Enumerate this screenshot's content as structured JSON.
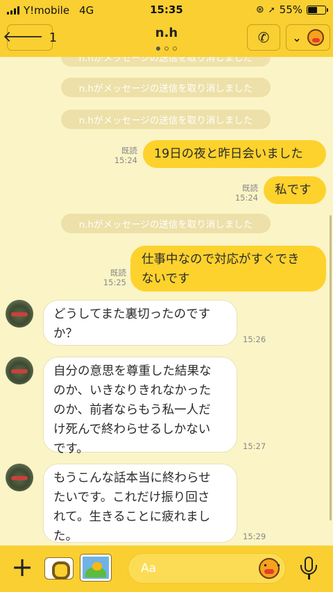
{
  "status": {
    "carrier": "Y!mobile",
    "network": "4G",
    "time": "15:35",
    "battery": "55%",
    "battery_level": 0.55
  },
  "header": {
    "back_count": "1",
    "title": "n.h",
    "page_dots": 3,
    "active_dot": 0
  },
  "chat": {
    "top_sys": "n.hがメッセージの送信を取り消しました",
    "sys1": "n.hがメッセージの送信を取り消しました",
    "sys2": "n.hがメッセージの送信を取り消しました",
    "out1": {
      "text": "19日の夜と昨日会いました",
      "read": "既読",
      "time": "15:24"
    },
    "out2": {
      "text": "私です",
      "read": "既読",
      "time": "15:24"
    },
    "sys3": "n.hがメッセージの送信を取り消しました",
    "out3": {
      "line1": "仕事中なので対応がすぐでき",
      "line2": "ないです",
      "read": "既読",
      "time": "15:25"
    },
    "in1": {
      "line1": "どうしてまた裏切ったのです",
      "line2": "か？",
      "time": "15:26"
    },
    "in2": {
      "line1": "自分の意思を尊重した結果な",
      "line2": "のか、いきなりきれなかった",
      "line3": "のか、前者ならもう私一人だ",
      "line4": "け死んで終わらせるしかない",
      "line5": "です。",
      "time": "15:27"
    },
    "in3": {
      "line1": "もうこんな話本当に終わらせ",
      "line2": "たいです。これだけ振り回さ",
      "line3": "れて。生きることに疲れまし",
      "line4": "た。",
      "time": "15:29"
    }
  },
  "composer": {
    "placeholder": "Aa"
  }
}
